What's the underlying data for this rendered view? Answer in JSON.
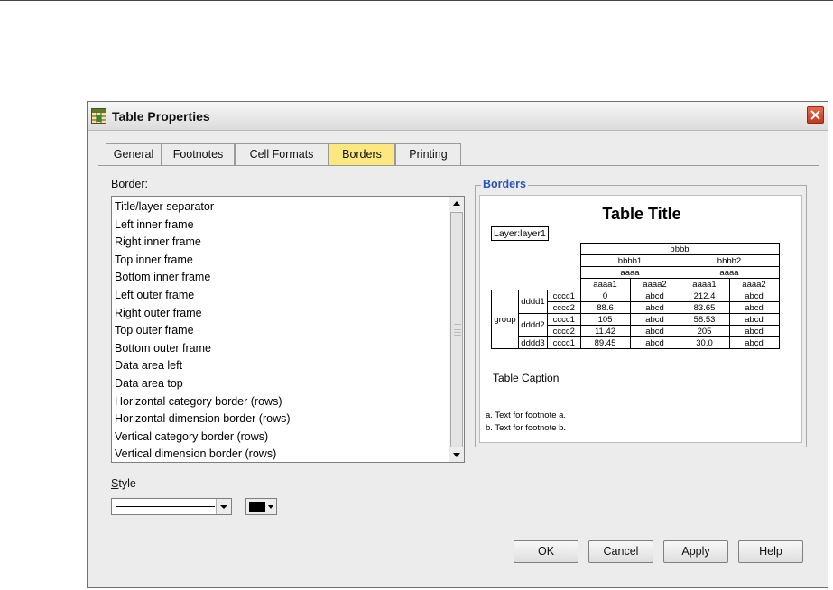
{
  "window": {
    "title": "Table Properties"
  },
  "tabs": [
    {
      "label": "General"
    },
    {
      "label": "Footnotes"
    },
    {
      "label": "Cell Formats"
    },
    {
      "label": "Borders",
      "active": true
    },
    {
      "label": "Printing"
    }
  ],
  "border_section": {
    "label": "Border:",
    "items": [
      "Title/layer separator",
      "Left inner frame",
      "Right inner frame",
      "Top inner frame",
      "Bottom inner frame",
      "Left outer frame",
      "Right outer frame",
      "Top outer frame",
      "Bottom outer frame",
      "Data area left",
      "Data area top",
      "Horizontal category border (rows)",
      "Horizontal dimension border (rows)",
      "Vertical category border (rows)",
      "Vertical dimension border (rows)"
    ]
  },
  "style_section": {
    "label": "Style",
    "line_color": "#000000"
  },
  "preview": {
    "group_title": "Borders",
    "table_title": "Table Title",
    "layer": "Layer:layer1",
    "col_header": "bbbb",
    "col_sub": [
      "bbbb1",
      "bbbb2"
    ],
    "col_sub2": [
      "aaaa",
      "aaaa"
    ],
    "col_leaf": [
      "aaaa1",
      "aaaa2",
      "aaaa1",
      "aaaa2"
    ],
    "row_group": "group",
    "rows": [
      {
        "d": "dddd1",
        "c": "cccc1",
        "v": [
          "0",
          "abcd",
          "212.4",
          "abcd"
        ]
      },
      {
        "d": "",
        "c": "cccc2",
        "v": [
          "88.6",
          "abcd",
          "83.65",
          "abcd"
        ]
      },
      {
        "d": "dddd2",
        "c": "cccc1",
        "v": [
          "105",
          "abcd",
          "58.53",
          "abcd"
        ]
      },
      {
        "d": "",
        "c": "cccc2",
        "v": [
          "11.42",
          "abcd",
          "205",
          "abcd"
        ]
      },
      {
        "d": "dddd3",
        "c": "cccc1",
        "v": [
          "89.45",
          "abcd",
          "30.0",
          "abcd"
        ]
      }
    ],
    "caption": "Table Caption",
    "footnotes": [
      "a. Text for footnote a.",
      "b. Text for footnote b."
    ]
  },
  "buttons": {
    "ok": "OK",
    "cancel": "Cancel",
    "apply": "Apply",
    "help": "Help"
  },
  "colors": {
    "active_tab": "#fce87f",
    "group_title": "#2a55b8",
    "close_button": "#c23a1f"
  }
}
